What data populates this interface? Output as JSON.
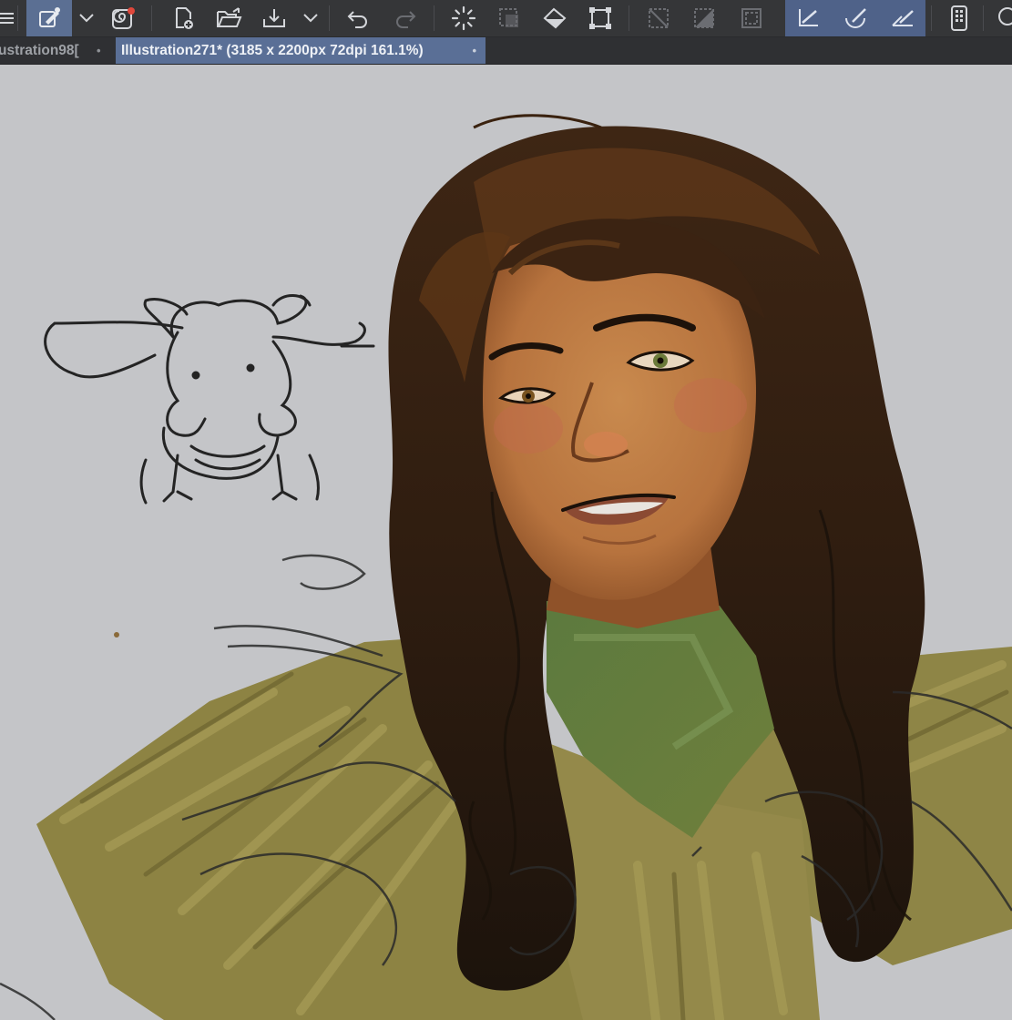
{
  "toolbar": {
    "tools": [
      {
        "name": "menu-icon",
        "state": "normal"
      },
      {
        "name": "pen-color-icon",
        "state": "active"
      },
      {
        "name": "chevron-down-icon",
        "state": "normal"
      },
      {
        "name": "spiral-app-icon",
        "state": "normal",
        "badge_color": "#e0473b"
      },
      {
        "name": "new-file-icon",
        "state": "normal"
      },
      {
        "name": "open-folder-icon",
        "state": "normal"
      },
      {
        "name": "save-icon",
        "state": "normal"
      },
      {
        "name": "undo-icon",
        "state": "normal"
      },
      {
        "name": "redo-icon",
        "state": "disabled"
      },
      {
        "name": "loading-icon",
        "state": "normal"
      },
      {
        "name": "select-icon",
        "state": "disabled"
      },
      {
        "name": "fill-bucket-icon",
        "state": "normal"
      },
      {
        "name": "transform-icon",
        "state": "normal"
      },
      {
        "name": "clear-selection-icon",
        "state": "disabled"
      },
      {
        "name": "invert-selection-icon",
        "state": "disabled"
      },
      {
        "name": "selection-border-icon",
        "state": "disabled"
      },
      {
        "name": "ruler-pen-icon",
        "state": "active"
      },
      {
        "name": "curve-ruler-icon",
        "state": "active"
      },
      {
        "name": "angle-ruler-icon",
        "state": "active"
      },
      {
        "name": "device-icon",
        "state": "normal"
      },
      {
        "name": "search-icon",
        "state": "normal"
      }
    ],
    "accent_color": "#5b6f93"
  },
  "tabs": [
    {
      "label": "ustration98[",
      "active": false,
      "modified_marker": "•"
    },
    {
      "label": "Illustration271* (3185 x 2200px 72dpi 161.1%)",
      "active": true,
      "modified_marker": "•"
    }
  ],
  "canvas": {
    "background": "#c4c5c8",
    "artwork": "digital painting of a girl with long brown wavy hair wearing a green scarf and a mustard fringed shawl, with a small line sketch of an animal"
  }
}
